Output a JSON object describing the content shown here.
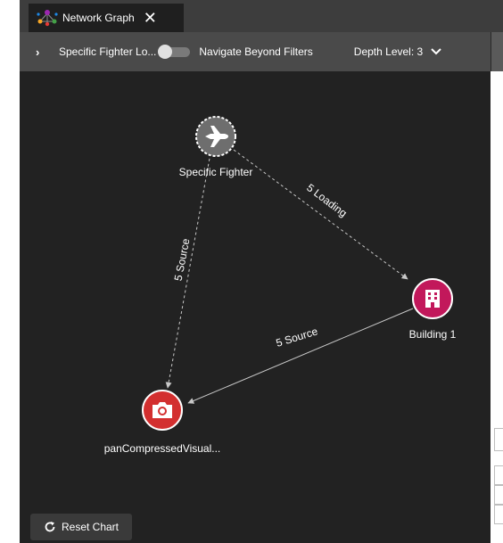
{
  "tab": {
    "title": "Network Graph",
    "icon": "network-graph-icon",
    "close_symbol": "✕"
  },
  "toolbar": {
    "expand_symbol": "›",
    "filter_label": "Specific Fighter Lo...",
    "navigate_toggle_on": false,
    "navigate_label": "Navigate Beyond Filters",
    "depth_label": "Depth Level: 3"
  },
  "graph": {
    "nodes": [
      {
        "id": "fighter",
        "label": "Specific Fighter",
        "icon": "fighter-jet-icon",
        "color": "#6e6e6e",
        "dashed_border": true
      },
      {
        "id": "building",
        "label": "Building 1",
        "icon": "building-icon",
        "color": "#c2185b",
        "dashed_border": false
      },
      {
        "id": "camera",
        "label": "panCompressedVisual...",
        "icon": "camera-icon",
        "color": "#d32f2f",
        "dashed_border": false
      }
    ],
    "edges": [
      {
        "from": "fighter",
        "to": "building",
        "label": "5 Loading",
        "dashed": true
      },
      {
        "from": "fighter",
        "to": "camera",
        "label": "5 Source",
        "dashed": true
      },
      {
        "from": "building",
        "to": "camera",
        "label": "5 Source",
        "dashed": false
      }
    ]
  },
  "reset": {
    "label": "Reset Chart",
    "icon": "refresh-icon"
  },
  "colors": {
    "canvas_bg": "#222222",
    "toolbar_bg": "#4a4a4a",
    "tabstrip_bg": "#3d3d3d",
    "edge_color": "#c8c8c8"
  }
}
